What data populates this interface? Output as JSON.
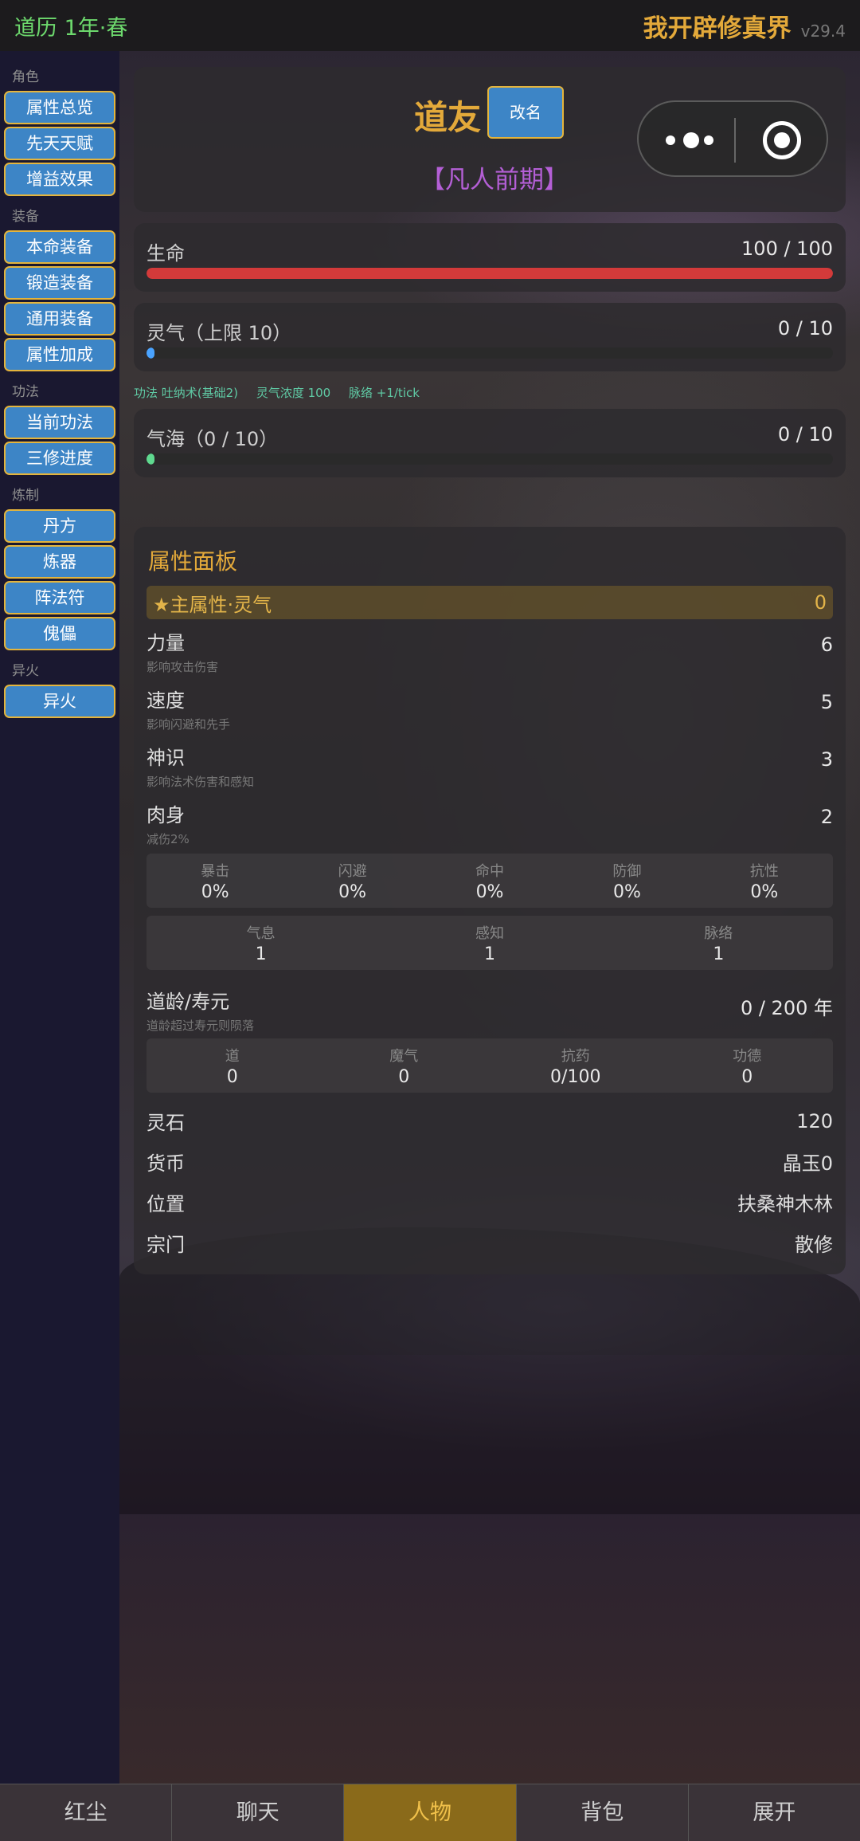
{
  "topbar": {
    "calendar": "道历 1年·春",
    "title": "我开辟修真界",
    "version": "v29.4"
  },
  "sidebar": {
    "sections": [
      {
        "label": "角色",
        "items": [
          "属性总览",
          "先天天赋",
          "增益效果"
        ]
      },
      {
        "label": "装备",
        "items": [
          "本命装备",
          "锻造装备",
          "通用装备",
          "属性加成"
        ]
      },
      {
        "label": "功法",
        "items": [
          "当前功法",
          "三修进度"
        ]
      },
      {
        "label": "炼制",
        "items": [
          "丹方",
          "炼器",
          "阵法符",
          "傀儡"
        ]
      },
      {
        "label": "异火",
        "items": [
          "异火"
        ]
      }
    ]
  },
  "character": {
    "name": "道友",
    "rename_label": "改名",
    "realm": "【凡人前期】"
  },
  "bars": {
    "hp": {
      "label": "生命",
      "value": "100 / 100",
      "fill_pct": 100
    },
    "qi": {
      "label": "灵气（上限 10）",
      "value": "0 / 10",
      "fill_pct": 1
    },
    "sea": {
      "label": "气海（0 / 10）",
      "value": "0 / 10",
      "fill_pct": 1
    }
  },
  "cultivation": {
    "technique": "功法 吐纳术(基础2)",
    "density": "灵气浓度 100",
    "meridian": "脉络 +1/tick"
  },
  "attributes": {
    "title": "属性面板",
    "main_label": "★主属性·灵气",
    "main_value": "0",
    "rows": [
      {
        "name": "力量",
        "desc": "影响攻击伤害",
        "value": "6"
      },
      {
        "name": "速度",
        "desc": "影响闪避和先手",
        "value": "5"
      },
      {
        "name": "神识",
        "desc": "影响法术伤害和感知",
        "value": "3"
      },
      {
        "name": "肉身",
        "desc": "减伤2%",
        "value": "2"
      }
    ],
    "combat": [
      {
        "label": "暴击",
        "value": "0%"
      },
      {
        "label": "闪避",
        "value": "0%"
      },
      {
        "label": "命中",
        "value": "0%"
      },
      {
        "label": "防御",
        "value": "0%"
      },
      {
        "label": "抗性",
        "value": "0%"
      }
    ],
    "secondary": [
      {
        "label": "气息",
        "value": "1"
      },
      {
        "label": "感知",
        "value": "1"
      },
      {
        "label": "脉络",
        "value": "1"
      }
    ],
    "lifespan": {
      "name": "道龄/寿元",
      "desc": "道龄超过寿元则陨落",
      "value": "0 / 200 年"
    },
    "misc": [
      {
        "label": "道",
        "value": "0"
      },
      {
        "label": "魔气",
        "value": "0"
      },
      {
        "label": "抗药",
        "value": "0/100"
      },
      {
        "label": "功德",
        "value": "0"
      }
    ],
    "info": [
      {
        "label": "灵石",
        "value": "120"
      },
      {
        "label": "货币",
        "value": "晶玉0"
      },
      {
        "label": "位置",
        "value": "扶桑神木林"
      },
      {
        "label": "宗门",
        "value": "散修"
      }
    ]
  },
  "nav": {
    "tabs": [
      "红尘",
      "聊天",
      "人物",
      "背包",
      "展开"
    ],
    "active_index": 2
  }
}
